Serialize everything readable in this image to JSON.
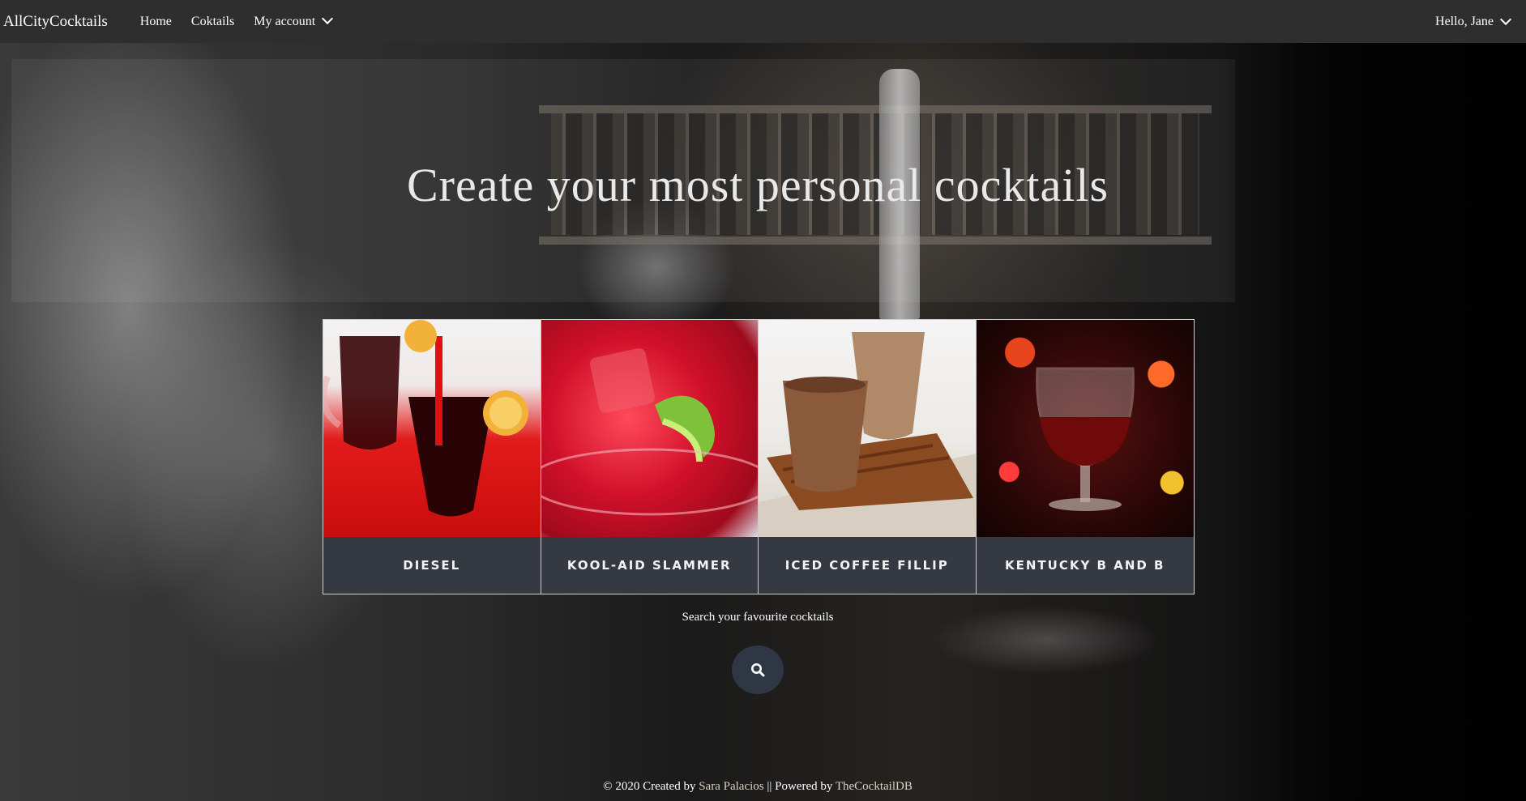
{
  "navbar": {
    "brand": "AllCityCocktails",
    "links": [
      "Home",
      "Coktails",
      "My account"
    ],
    "user_greeting": "Hello, Jane"
  },
  "hero": {
    "title": "Create your most personal cocktails"
  },
  "cocktails": [
    {
      "name": "Diesel"
    },
    {
      "name": "Kool-Aid Slammer"
    },
    {
      "name": "Iced Coffee Fillip"
    },
    {
      "name": "Kentucky B and B"
    }
  ],
  "search": {
    "label": "Search your favourite cocktails",
    "icon": "search-icon"
  },
  "footer": {
    "prefix": "© 2020 Created by",
    "author": "Sara Palacios",
    "separator": "|| Powered by",
    "source": "TheCocktailDB"
  }
}
